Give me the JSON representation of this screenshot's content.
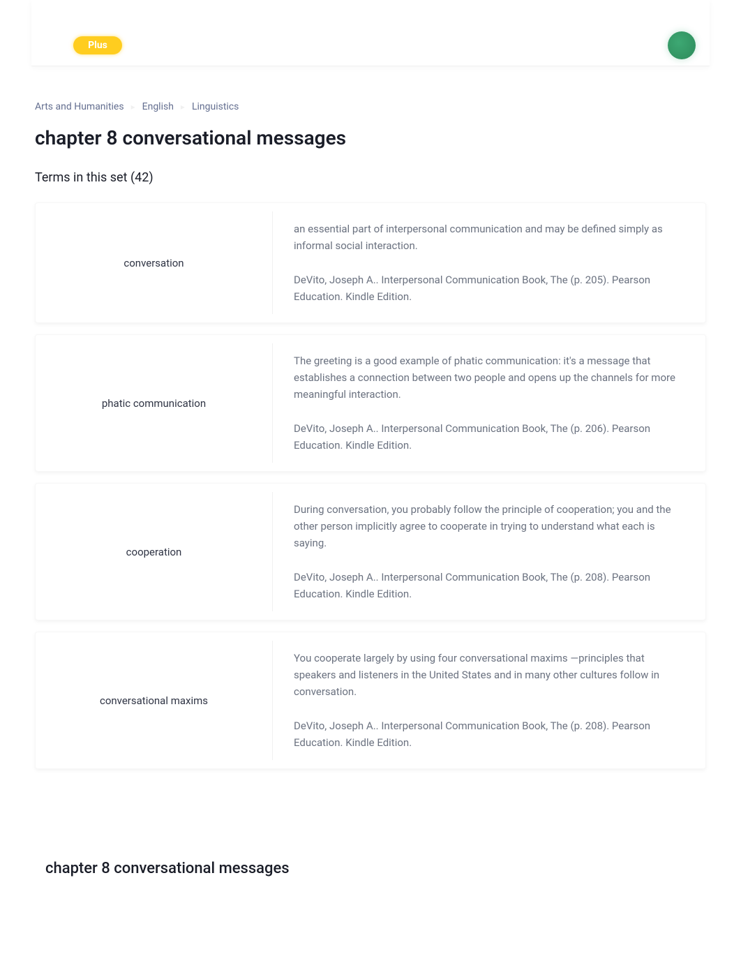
{
  "header": {
    "plus_label": "Plus"
  },
  "breadcrumb": {
    "items": [
      "Arts and Humanities",
      "English",
      "Linguistics"
    ]
  },
  "page_title": "chapter 8 conversational messages",
  "subtitle": "Terms in this set (42)",
  "cards": [
    {
      "term": "conversation",
      "definition": "an essential part of interpersonal communication and may be defined simply as informal social interaction.",
      "citation": "DeVito, Joseph A.. Interpersonal Communication Book, The (p. 205). Pearson Education. Kindle Edition."
    },
    {
      "term": "phatic communication",
      "definition": "The greeting is a good example of phatic communication: it's a message that establishes a connection between two people and opens up the channels for more meaningful interaction.",
      "citation": "DeVito, Joseph A.. Interpersonal Communication Book, The (p. 206). Pearson Education. Kindle Edition."
    },
    {
      "term": "cooperation",
      "definition": "During conversation, you probably follow the principle of cooperation; you and the other person implicitly agree to cooperate in trying to understand what each is saying.",
      "citation": "DeVito, Joseph A.. Interpersonal Communication Book, The (p. 208). Pearson Education. Kindle Edition."
    },
    {
      "term": "conversational maxims",
      "definition": "You cooperate largely by using four conversational maxims           —principles that speakers and listeners in the United States and in many other cultures follow in conversation.",
      "citation": "DeVito, Joseph A.. Interpersonal Communication Book, The (p. 208). Pearson Education. Kindle Edition."
    }
  ],
  "footer_title": "chapter 8 conversational messages"
}
